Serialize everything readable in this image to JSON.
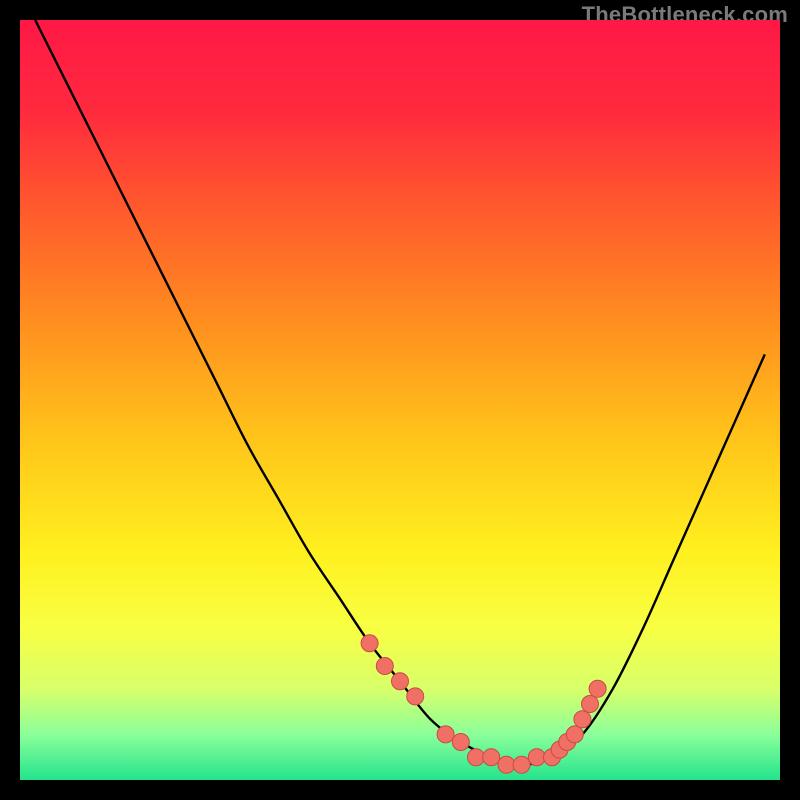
{
  "attribution": "TheBottleneck.com",
  "colors": {
    "frame": "#000000",
    "curve": "#000000",
    "dot_fill": "#f07066",
    "dot_stroke": "#c94b41",
    "gradient_stops": [
      {
        "offset": 0.0,
        "color": "#ff1846"
      },
      {
        "offset": 0.12,
        "color": "#ff2a3e"
      },
      {
        "offset": 0.25,
        "color": "#ff5a2c"
      },
      {
        "offset": 0.4,
        "color": "#ff8f1f"
      },
      {
        "offset": 0.55,
        "color": "#ffc41a"
      },
      {
        "offset": 0.7,
        "color": "#fff01f"
      },
      {
        "offset": 0.8,
        "color": "#f8ff43"
      },
      {
        "offset": 0.88,
        "color": "#d8ff6a"
      },
      {
        "offset": 0.94,
        "color": "#8bff9a"
      },
      {
        "offset": 1.0,
        "color": "#24e38d"
      }
    ]
  },
  "chart_data": {
    "type": "line",
    "title": "",
    "xlabel": "",
    "ylabel": "",
    "xlim": [
      0,
      100
    ],
    "ylim": [
      0,
      100
    ],
    "series": [
      {
        "name": "bottleneck_curve",
        "x": [
          2,
          6,
          10,
          14,
          18,
          22,
          26,
          30,
          34,
          38,
          42,
          46,
          50,
          54,
          58,
          62,
          66,
          70,
          74,
          78,
          82,
          86,
          90,
          94,
          98
        ],
        "y": [
          100,
          92,
          84,
          76,
          68,
          60,
          52,
          44,
          37,
          30,
          24,
          18,
          13,
          8,
          5,
          3,
          2,
          3,
          6,
          12,
          20,
          29,
          38,
          47,
          56
        ]
      }
    ],
    "highlight_dots": {
      "name": "selected_range_markers",
      "x": [
        46,
        48,
        50,
        52,
        56,
        58,
        60,
        62,
        64,
        66,
        68,
        70,
        71,
        72,
        73,
        74,
        75,
        76
      ],
      "y": [
        18,
        15,
        13,
        11,
        6,
        5,
        3,
        3,
        2,
        2,
        3,
        3,
        4,
        5,
        6,
        8,
        10,
        12
      ]
    }
  }
}
